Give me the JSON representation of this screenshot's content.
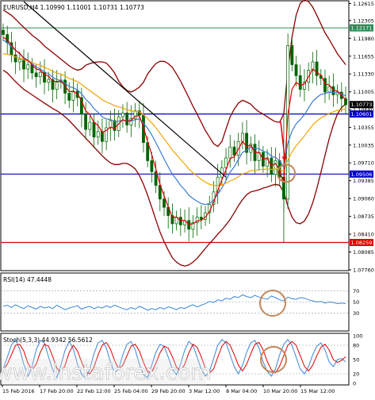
{
  "colors": {
    "candle": "#006400",
    "bb": "#8b0000",
    "ma_blue": "#3a7bd5",
    "ma_orange": "#f0a500",
    "ma_red": "#e00000",
    "trendline": "#000000",
    "level_blue": "#0000cc",
    "level_green": "#2e8b57",
    "level_red": "#e00000",
    "circle": "#c0875a",
    "arrow": "#e00000",
    "rsi": "#3a86d8",
    "stoch_main": "#3a86d8",
    "stoch_signal": "#e00000",
    "watermark": "#ffffff"
  },
  "chart_data": [
    {
      "type": "candlestick",
      "title": "EURUSD,H4 1.10990 1.11001 1.10731 1.10773",
      "symbol": "EURUSD,H4",
      "ohlc_header": [
        "1.10990",
        "1.11001",
        "1.10731",
        "1.10773"
      ],
      "ylim": [
        1.0776,
        1.1265
      ],
      "y_ticks": [
        "1.12615",
        "1.12305",
        "1.11980",
        "1.11655",
        "1.11330",
        "1.11005",
        "1.10680",
        "1.10355",
        "1.10035",
        "1.09710",
        "1.09385",
        "1.09060",
        "1.08735",
        "1.08410",
        "1.08085",
        "1.07760"
      ],
      "levels": [
        {
          "label": "1.12171",
          "value": 1.12171,
          "color": "#2e8b57"
        },
        {
          "label": "1.10773",
          "value": 1.10773,
          "color": "#000000"
        },
        {
          "label": "1.10601",
          "value": 1.10601,
          "color": "#0000cc"
        },
        {
          "label": "1.09506",
          "value": 1.09506,
          "color": "#0000cc"
        },
        {
          "label": "1.08259",
          "value": 1.08259,
          "color": "#e00000"
        }
      ],
      "x_labels": [
        "15 Feb 2016",
        "17 Feb 20:00",
        "22 Feb 12:00",
        "25 Feb 04:00",
        "29 Feb 20:00",
        "3 Mar 12:00",
        "8 Mar 04:00",
        "10 Mar 20:00",
        "15 Mar 12:00"
      ],
      "close_series": [
        1.1205,
        1.119,
        1.1168,
        1.1155,
        1.116,
        1.1142,
        1.115,
        1.1135,
        1.1128,
        1.1136,
        1.1118,
        1.1123,
        1.1105,
        1.1118,
        1.1122,
        1.1098,
        1.1085,
        1.1102,
        1.109,
        1.106,
        1.1032,
        1.1045,
        1.1018,
        1.1028,
        1.101,
        1.1035,
        1.1048,
        1.103,
        1.1055,
        1.1062,
        1.104,
        1.1052,
        1.1066,
        1.1058,
        1.1008,
        1.0975,
        1.0955,
        1.093,
        1.0905,
        1.089,
        1.0875,
        1.086,
        1.0872,
        1.0858,
        1.0866,
        1.085,
        1.0862,
        1.0872,
        1.0868,
        1.088,
        1.0895,
        1.0918,
        1.0945,
        1.0962,
        1.098,
        1.1,
        1.0985,
        1.101,
        1.1025,
        1.099,
        1.1005,
        1.0975,
        1.099,
        1.0965,
        1.098,
        1.095,
        1.0975,
        1.0945,
        1.0905,
        1.1185,
        1.115,
        1.113,
        1.1105,
        1.1118,
        1.114,
        1.1155,
        1.113,
        1.1125,
        1.11,
        1.111,
        1.1095,
        1.11,
        1.1088,
        1.1077
      ],
      "series": [
        {
          "name": "",
          "color_key": "ma_blue",
          "values": [
            1.1195,
            1.119,
            1.1183,
            1.1176,
            1.117,
            1.1163,
            1.1158,
            1.1152,
            1.1146,
            1.1142,
            1.1137,
            1.1133,
            1.1127,
            1.1123,
            1.1121,
            1.1116,
            1.111,
            1.1108,
            1.1104,
            1.1097,
            1.1087,
            1.108,
            1.107,
            1.1063,
            1.1055,
            1.1051,
            1.105,
            1.1046,
            1.1047,
            1.1049,
            1.1047,
            1.1047,
            1.105,
            1.1051,
            1.1043,
            1.1034,
            1.1022,
            1.1008,
            1.0993,
            1.0978,
            1.0964,
            1.095,
            1.0941,
            1.093,
            1.0922,
            1.0912,
            1.0906,
            1.0901,
            1.0897,
            1.0895,
            1.0897,
            1.0903,
            1.0914,
            1.0925,
            1.0939,
            1.0954,
            1.0964,
            1.0977,
            1.099,
            1.0994,
            1.1,
            1.0997,
            1.0997,
            1.0992,
            1.099,
            1.0983,
            1.0981,
            1.0975,
            1.0963,
            1.1007,
            1.1029,
            1.1042,
            1.105,
            1.1059,
            1.1071,
            1.1083,
            1.109,
            1.1096,
            1.1097,
            1.11,
            1.1099,
            1.1099,
            1.1097,
            1.1093
          ]
        },
        {
          "name": "",
          "color_key": "ma_orange",
          "values": [
            1.117,
            1.1169,
            1.1167,
            1.1164,
            1.1162,
            1.1159,
            1.1157,
            1.1154,
            1.1151,
            1.1149,
            1.1145,
            1.1142,
            1.1138,
            1.1135,
            1.1133,
            1.1129,
            1.1125,
            1.1122,
            1.1119,
            1.1114,
            1.1108,
            1.1103,
            1.1097,
            1.1092,
            1.1086,
            1.1082,
            1.1079,
            1.1075,
            1.1073,
            1.1071,
            1.1068,
            1.1066,
            1.1065,
            1.1064,
            1.1059,
            1.1052,
            1.1044,
            1.1035,
            1.1025,
            1.1015,
            1.1005,
            1.0994,
            1.0986,
            1.0977,
            1.0969,
            1.096,
            1.0953,
            1.0947,
            1.0941,
            1.0936,
            1.0932,
            1.093,
            1.093,
            1.0931,
            1.0934,
            1.0938,
            1.0941,
            1.0946,
            1.0951,
            1.0953,
            1.0957,
            1.0957,
            1.0959,
            1.0959,
            1.096,
            1.0959,
            1.096,
            1.0959,
            1.0956,
            1.0976,
            1.0991,
            1.1002,
            1.1011,
            1.102,
            1.103,
            1.104,
            1.1047,
            1.1053,
            1.1057,
            1.1061,
            1.1064,
            1.1067,
            1.1068,
            1.1069
          ]
        },
        {
          "name": "",
          "color_key": "ma_red",
          "values": [
            1.12,
            1.1195,
            1.1186,
            1.1176,
            1.1171,
            1.1161,
            1.1158,
            1.115,
            1.1142,
            1.114,
            1.1132,
            1.1129,
            1.112,
            1.1119,
            1.112,
            1.1111,
            1.1101,
            1.1101,
            1.1097,
            1.1084,
            1.1066,
            1.1059,
            1.1045,
            1.1039,
            1.1027,
            1.103,
            1.1036,
            1.1034,
            1.1042,
            1.105,
            1.1046,
            1.1049,
            1.1056,
            1.1057,
            1.1036,
            1.101,
            1.0986,
            1.096,
            1.0932,
            1.0911,
            1.0891,
            1.0872,
            1.0872,
            1.0866,
            1.0866,
            1.0859,
            1.086,
            1.0865,
            1.0866,
            1.0872,
            1.0882,
            1.0899,
            1.0921,
            1.094,
            1.0959,
            1.0979,
            1.0982,
            1.0996,
            1.101,
            1.1001,
            1.1003,
            1.099,
            1.099,
            1.0978,
            1.0979,
            1.0965,
            1.097,
            1.0958,
            1.0932,
            1.1059,
            1.1105,
            1.1118,
            1.1112,
            1.1115,
            1.1128,
            1.1142,
            1.1136,
            1.1131,
            1.1115,
            1.1113,
            1.1104,
            1.1102,
            1.1095,
            1.1086
          ]
        }
      ],
      "bollinger": {
        "upper": [
          1.125,
          1.1245,
          1.124,
          1.1233,
          1.1225,
          1.1218,
          1.1211,
          1.1204,
          1.1198,
          1.1192,
          1.1184,
          1.1178,
          1.1172,
          1.1166,
          1.116,
          1.1154,
          1.1148,
          1.1143,
          1.114,
          1.1142,
          1.1149,
          1.1152,
          1.1154,
          1.1155,
          1.1155,
          1.1153,
          1.1145,
          1.1135,
          1.112,
          1.111,
          1.1103,
          1.11,
          1.1104,
          1.1109,
          1.1118,
          1.1133,
          1.1143,
          1.1152,
          1.1156,
          1.1156,
          1.1152,
          1.1145,
          1.1133,
          1.112,
          1.1105,
          1.109,
          1.1074,
          1.106,
          1.1045,
          1.103,
          1.1018,
          1.1006,
          1.1001,
          1.101,
          1.1033,
          1.1055,
          1.1069,
          1.108,
          1.1085,
          1.1082,
          1.1078,
          1.107,
          1.1064,
          1.106,
          1.1055,
          1.105,
          1.1046,
          1.1045,
          1.106,
          1.114,
          1.12,
          1.124,
          1.1262,
          1.1268,
          1.1265,
          1.1255,
          1.124,
          1.1224,
          1.1208,
          1.1196,
          1.1183,
          1.117,
          1.116,
          1.115
        ],
        "lower": [
          1.114,
          1.1135,
          1.1127,
          1.1119,
          1.1112,
          1.1105,
          1.11,
          1.1095,
          1.109,
          1.1085,
          1.108,
          1.1075,
          1.107,
          1.1066,
          1.1061,
          1.1055,
          1.1048,
          1.104,
          1.1032,
          1.1024,
          1.1016,
          1.1008,
          1.1,
          1.0992,
          1.0984,
          1.0977,
          1.0971,
          1.0968,
          1.0968,
          1.097,
          1.097,
          1.0966,
          1.096,
          1.0948,
          1.0932,
          1.0912,
          1.089,
          1.0867,
          1.0845,
          1.0827,
          1.0812,
          1.0798,
          1.079,
          1.0785,
          1.0783,
          1.0785,
          1.079,
          1.0797,
          1.0806,
          1.0815,
          1.0824,
          1.0832,
          1.0841,
          1.0849,
          1.0858,
          1.0868,
          1.088,
          1.0893,
          1.0904,
          1.0913,
          1.0918,
          1.092,
          1.0922,
          1.0925,
          1.0927,
          1.093,
          1.0932,
          1.093,
          1.0918,
          1.0892,
          1.0872,
          1.0862,
          1.086,
          1.0865,
          1.0878,
          1.0898,
          1.0924,
          1.0954,
          1.0985,
          1.1015,
          1.104,
          1.106,
          1.1072,
          1.1078
        ]
      }
    },
    {
      "type": "line",
      "title": "RSI(14) 47.4448",
      "ylim": [
        0,
        100
      ],
      "y_ticks": [
        "70",
        "50",
        "30"
      ],
      "series": [
        {
          "name": "",
          "color_key": "rsi",
          "values": [
            42,
            44,
            40,
            45,
            41,
            38,
            43,
            40,
            37,
            42,
            39,
            41,
            38,
            44,
            40,
            36,
            39,
            41,
            43,
            37,
            40,
            42,
            38,
            41,
            39,
            43,
            40,
            44,
            41,
            38,
            36,
            40,
            37,
            42,
            39,
            35,
            38,
            36,
            40,
            37,
            41,
            39,
            36,
            40,
            38,
            42,
            45,
            41,
            44,
            47,
            51,
            49,
            54,
            52,
            57,
            55,
            60,
            58,
            63,
            60,
            58,
            62,
            59,
            57,
            55,
            61,
            58,
            54,
            52,
            59,
            56,
            55,
            58,
            57,
            54,
            52,
            50,
            51,
            48,
            50,
            49,
            47,
            48,
            47
          ]
        }
      ]
    },
    {
      "type": "line",
      "title": "Stoch(5,3,3) 44.9342 56.5612",
      "ylim": [
        0,
        100
      ],
      "y_ticks": [
        "100",
        "80",
        "50",
        "20",
        "0"
      ],
      "series": [
        {
          "name": "",
          "color_key": "stoch_main",
          "values": [
            30,
            55,
            80,
            92,
            72,
            40,
            15,
            35,
            70,
            90,
            85,
            55,
            28,
            12,
            38,
            70,
            88,
            72,
            40,
            20,
            10,
            30,
            62,
            85,
            90,
            74,
            45,
            22,
            30,
            60,
            82,
            88,
            70,
            40,
            18,
            12,
            38,
            65,
            82,
            78,
            55,
            30,
            18,
            40,
            70,
            88,
            80,
            55,
            30,
            15,
            25,
            52,
            80,
            92,
            85,
            60,
            35,
            20,
            38,
            65,
            85,
            90,
            74,
            45,
            25,
            15,
            30,
            60,
            82,
            92,
            80,
            55,
            30,
            20,
            35,
            60,
            78,
            85,
            70,
            45,
            35,
            50,
            52,
            45
          ]
        },
        {
          "name": "",
          "color_key": "stoch_signal",
          "values": [
            28,
            40,
            60,
            80,
            82,
            68,
            42,
            28,
            40,
            65,
            82,
            78,
            56,
            32,
            22,
            38,
            65,
            80,
            68,
            45,
            24,
            20,
            34,
            60,
            80,
            86,
            72,
            48,
            30,
            38,
            58,
            78,
            82,
            68,
            44,
            24,
            24,
            42,
            64,
            78,
            74,
            56,
            34,
            26,
            40,
            64,
            82,
            76,
            56,
            32,
            22,
            30,
            55,
            78,
            88,
            80,
            60,
            38,
            26,
            40,
            62,
            82,
            86,
            70,
            46,
            28,
            22,
            36,
            58,
            80,
            88,
            80,
            58,
            36,
            26,
            38,
            58,
            76,
            82,
            70,
            50,
            44,
            48,
            56
          ]
        }
      ]
    }
  ],
  "watermark": {
    "text": "www.instaforex.com"
  }
}
